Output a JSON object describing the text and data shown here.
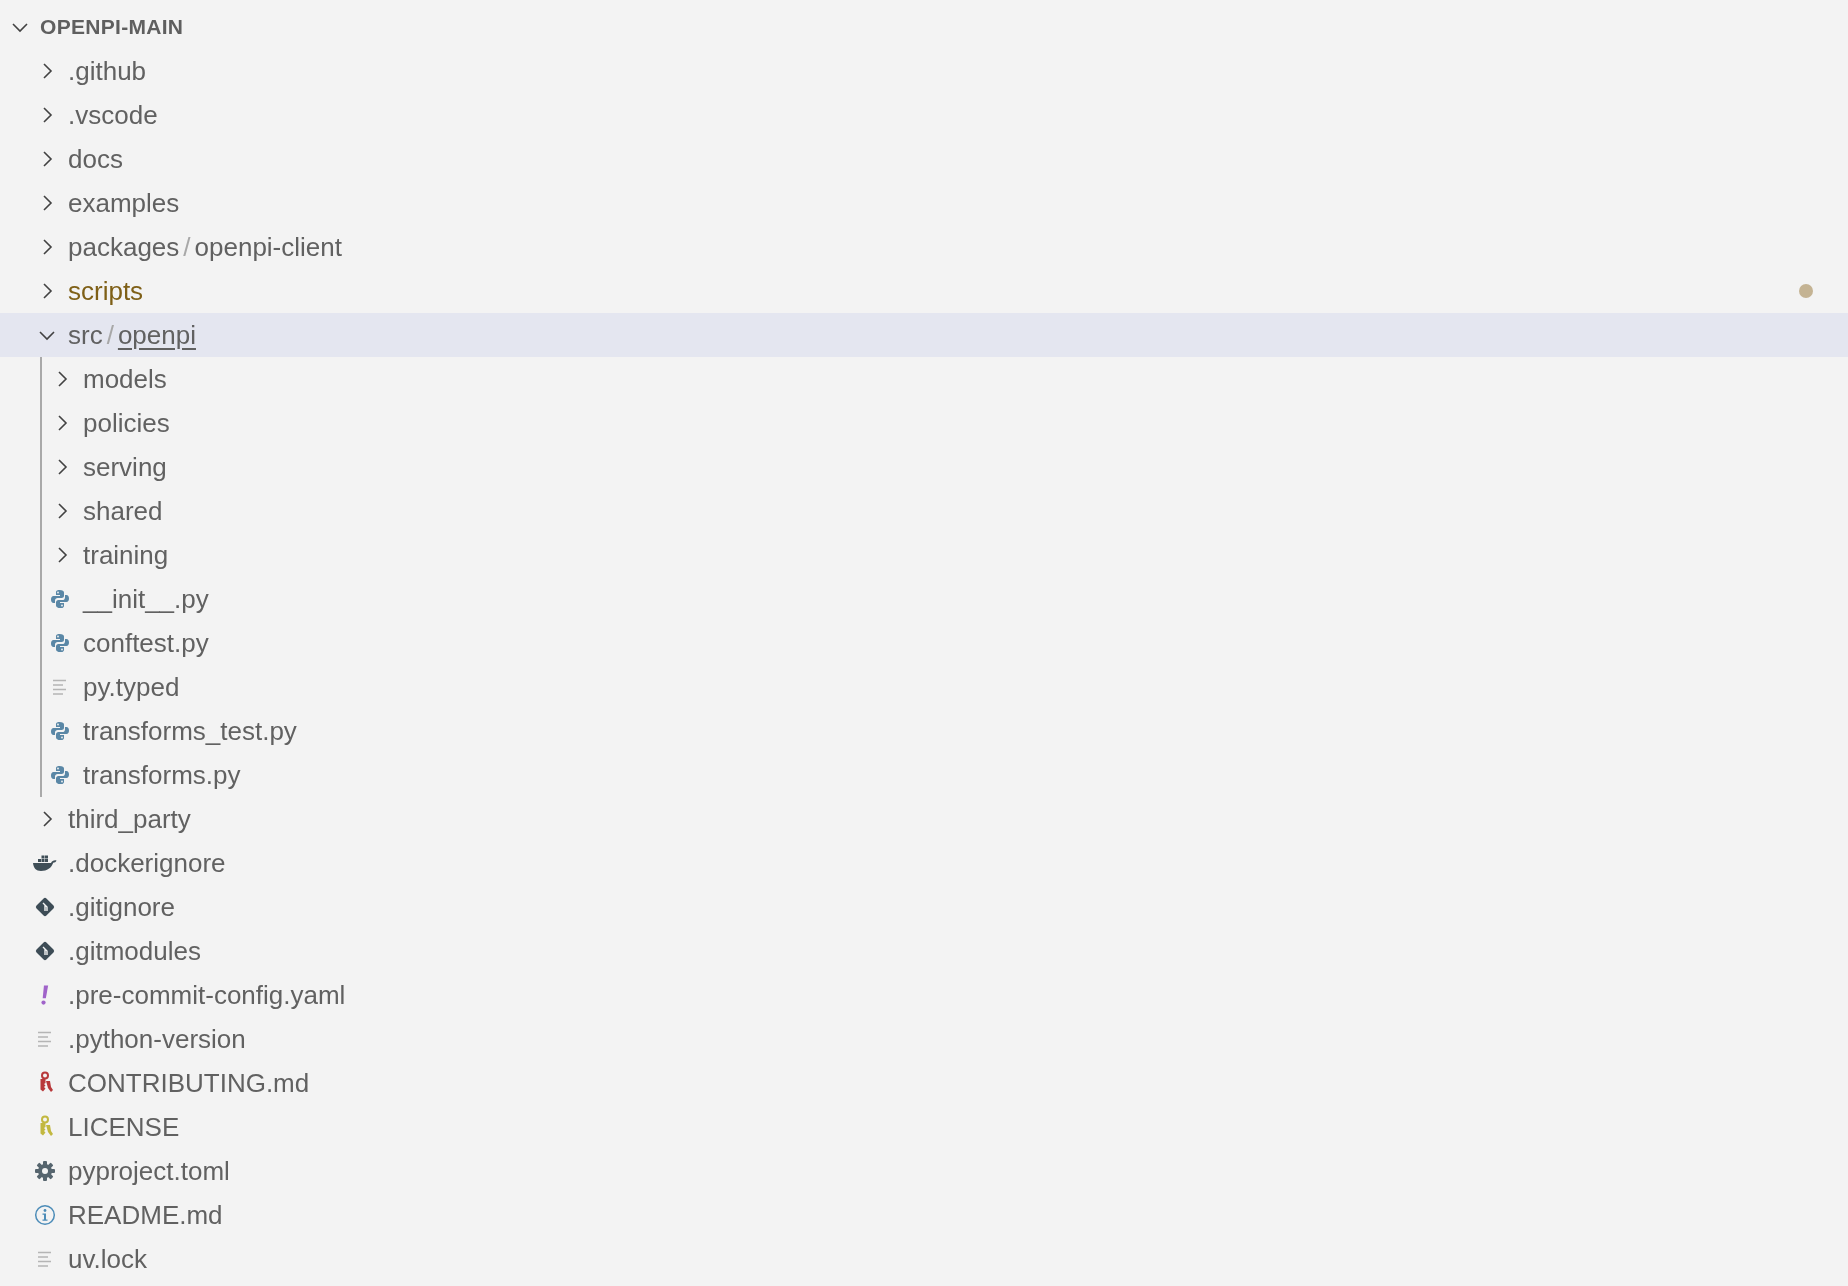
{
  "explorer": {
    "title": "OPENPI-MAIN",
    "expanded": true,
    "items": [
      {
        "kind": "folder",
        "name": ".github",
        "expanded": false
      },
      {
        "kind": "folder",
        "name": ".vscode",
        "expanded": false
      },
      {
        "kind": "folder",
        "name": "docs",
        "expanded": false
      },
      {
        "kind": "folder",
        "name": "examples",
        "expanded": false
      },
      {
        "kind": "folder",
        "segments": [
          {
            "label": "packages",
            "underlined": false
          },
          {
            "label": "openpi-client",
            "underlined": false
          }
        ],
        "separator": "/",
        "expanded": false
      },
      {
        "kind": "folder",
        "name": "scripts",
        "expanded": false,
        "modified": true,
        "color": "#c4b393"
      },
      {
        "kind": "folder",
        "segments": [
          {
            "label": "src",
            "underlined": false
          },
          {
            "label": "openpi",
            "underlined": true
          }
        ],
        "separator": "/",
        "expanded": true,
        "selected": true,
        "children": [
          {
            "kind": "folder",
            "name": "models",
            "expanded": false
          },
          {
            "kind": "folder",
            "name": "policies",
            "expanded": false
          },
          {
            "kind": "folder",
            "name": "serving",
            "expanded": false
          },
          {
            "kind": "folder",
            "name": "shared",
            "expanded": false
          },
          {
            "kind": "folder",
            "name": "training",
            "expanded": false
          },
          {
            "kind": "python",
            "name": "__init__.py"
          },
          {
            "kind": "python",
            "name": "conftest.py"
          },
          {
            "kind": "text",
            "name": "py.typed"
          },
          {
            "kind": "python",
            "name": "transforms_test.py"
          },
          {
            "kind": "python",
            "name": "transforms.py"
          }
        ]
      },
      {
        "kind": "folder",
        "name": "third_party",
        "expanded": false
      },
      {
        "kind": "docker",
        "name": ".dockerignore"
      },
      {
        "kind": "git",
        "name": ".gitignore"
      },
      {
        "kind": "git",
        "name": ".gitmodules"
      },
      {
        "kind": "yaml",
        "name": ".pre-commit-config.yaml"
      },
      {
        "kind": "text",
        "name": ".python-version"
      },
      {
        "kind": "keys",
        "name": "CONTRIBUTING.md",
        "color": "#b8393b"
      },
      {
        "kind": "keys",
        "name": "LICENSE",
        "color": "#c2b840"
      },
      {
        "kind": "gear",
        "name": "pyproject.toml"
      },
      {
        "kind": "info",
        "name": "README.md"
      },
      {
        "kind": "text",
        "name": "uv.lock"
      }
    ]
  }
}
